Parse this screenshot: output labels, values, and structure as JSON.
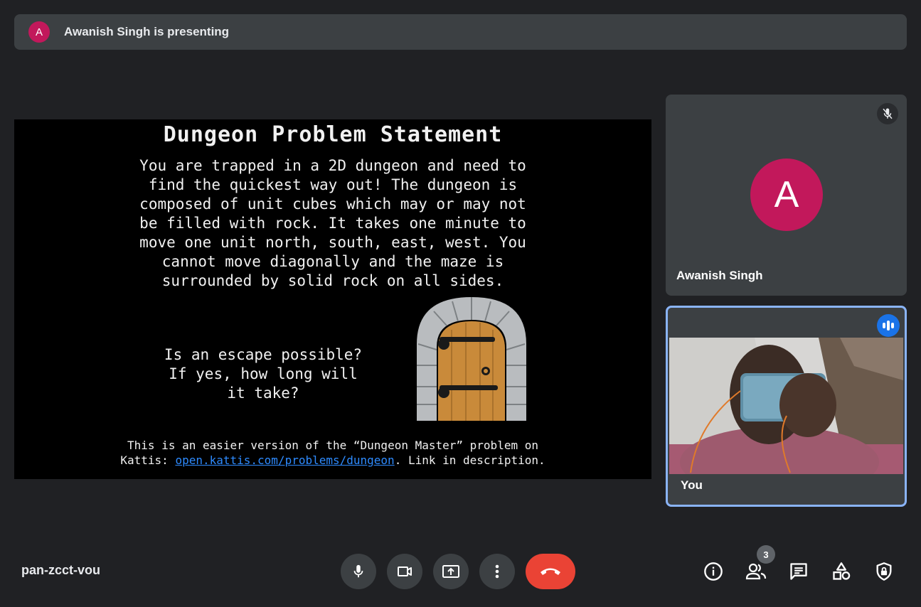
{
  "banner": {
    "avatar_letter": "A",
    "text": "Awanish Singh is presenting"
  },
  "slide": {
    "title": "Dungeon Problem Statement",
    "body": "You are trapped in a 2D dungeon and need to\nfind the quickest way out! The dungeon is\ncomposed of unit cubes which may or may not\nbe filled with rock. It takes one minute to\nmove one unit north, south, east, west. You\ncannot move diagonally and the maze is\nsurrounded by solid rock on all sides.",
    "question": "Is an escape possible?\nIf yes, how long will\nit take?",
    "footnote_line1": "This is an easier version of the “Dungeon Master” problem on",
    "footnote_prefix": "Kattis: ",
    "footnote_link": "open.kattis.com/problems/dungeon",
    "footnote_suffix": ". Link in description."
  },
  "participants": [
    {
      "name": "Awanish Singh",
      "avatar_letter": "A",
      "muted": true
    },
    {
      "name": "You",
      "speaking": true
    }
  ],
  "meeting_code": "pan-zcct-vou",
  "people_count": "3",
  "controls": [
    "microphone",
    "camera",
    "present-screen",
    "more-options",
    "leave-call"
  ],
  "right_icons": [
    "meeting-info",
    "people",
    "chat",
    "activities",
    "host-controls"
  ],
  "colors": {
    "background": "#202124",
    "surface": "#3c4043",
    "avatar": "#c2185b",
    "end_call": "#ea4335",
    "speaking_accent": "#8ab4f8",
    "link": "#2e8bff"
  }
}
